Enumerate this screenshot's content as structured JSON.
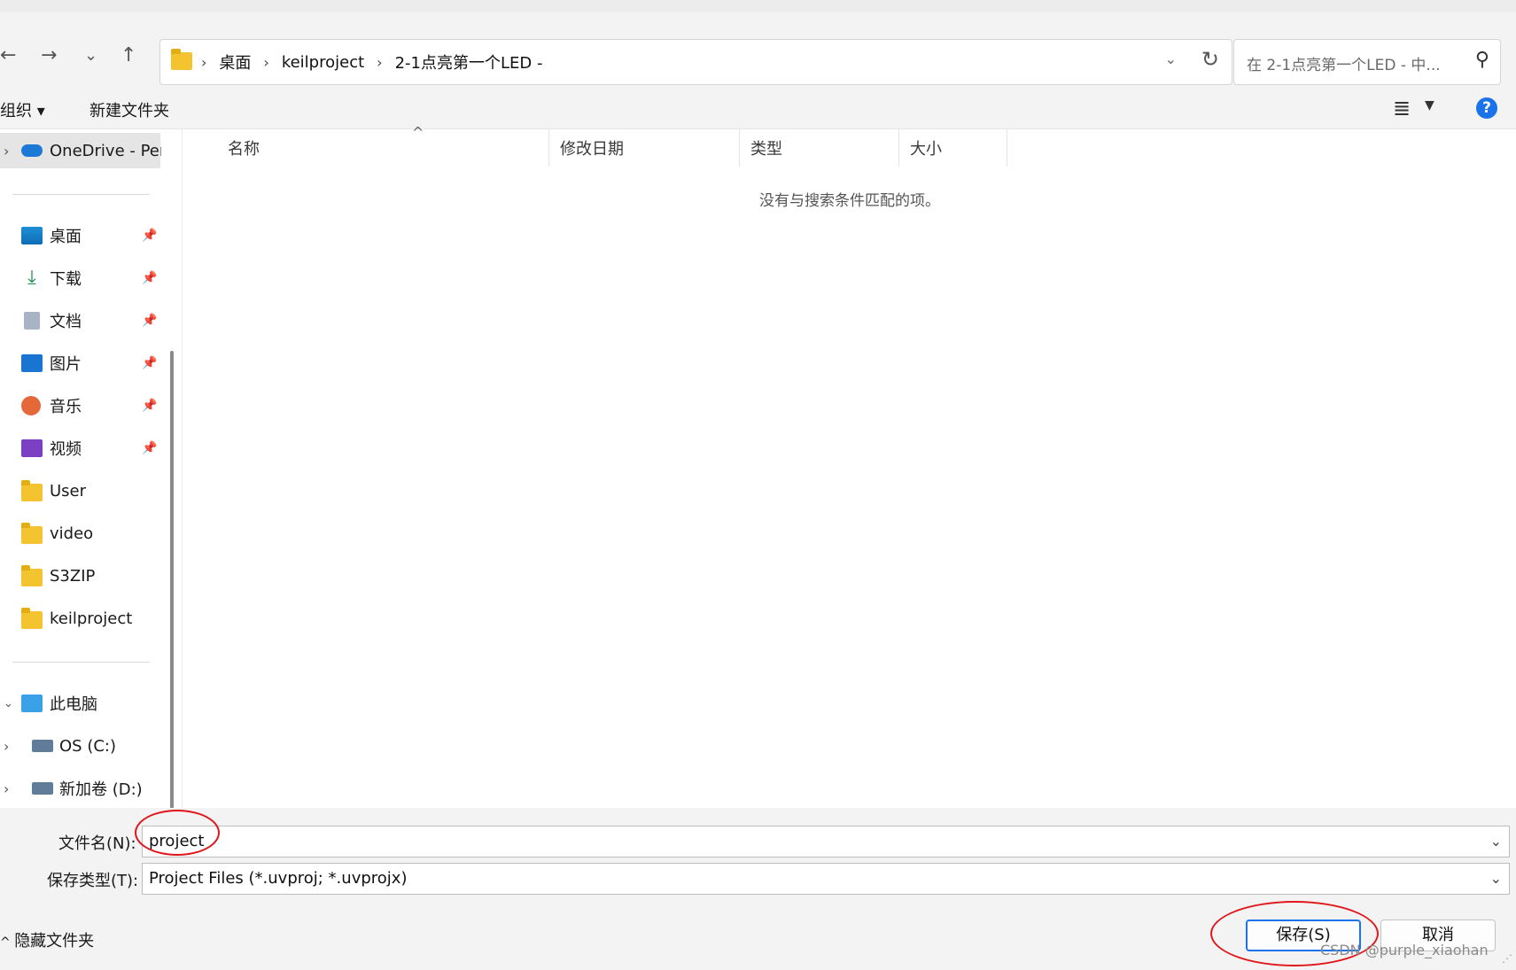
{
  "nav": {
    "back": "←",
    "forward": "→",
    "recent": "⌄",
    "up": "↑",
    "breadcrumbs": [
      "桌面",
      "keilproject",
      "2-1点亮第一个LED -"
    ],
    "search_placeholder": "在 2-1点亮第一个LED - 中..."
  },
  "toolbar": {
    "organize": "组织 ▾",
    "new_folder": "新建文件夹",
    "help": "?"
  },
  "sidebar": {
    "onedrive": "OneDrive - Per",
    "quick_access": [
      {
        "label": "桌面",
        "icon": "desktop-icon",
        "pinned": true
      },
      {
        "label": "下载",
        "icon": "download-icon",
        "pinned": true
      },
      {
        "label": "文档",
        "icon": "document-icon",
        "pinned": true
      },
      {
        "label": "图片",
        "icon": "pictures-icon",
        "pinned": true
      },
      {
        "label": "音乐",
        "icon": "music-icon",
        "pinned": true
      },
      {
        "label": "视频",
        "icon": "video-icon",
        "pinned": true
      },
      {
        "label": "User",
        "icon": "folder-icon",
        "pinned": false
      },
      {
        "label": "video",
        "icon": "folder-icon",
        "pinned": false
      },
      {
        "label": "S3ZIP",
        "icon": "folder-icon",
        "pinned": false
      },
      {
        "label": "keilproject",
        "icon": "folder-icon",
        "pinned": false
      }
    ],
    "this_pc": "此电脑",
    "drives": [
      {
        "label": "OS (C:)",
        "icon": "drive-icon"
      },
      {
        "label": "新加卷 (D:)",
        "icon": "drive-icon"
      }
    ]
  },
  "columns": [
    "名称",
    "修改日期",
    "类型",
    "大小"
  ],
  "empty_message": "没有与搜索条件匹配的项。",
  "form": {
    "filename_label": "文件名(N):",
    "filename_value": "project",
    "filetype_label": "保存类型(T):",
    "filetype_value": "Project Files (*.uvproj; *.uvprojx)"
  },
  "footer": {
    "hide_folders": "隐藏文件夹",
    "save": "保存(S)",
    "cancel": "取消"
  },
  "watermark": "CSDN @purple_xiaohan",
  "colors": {
    "accent": "#1a73e8",
    "annotation": "#e0161b"
  }
}
